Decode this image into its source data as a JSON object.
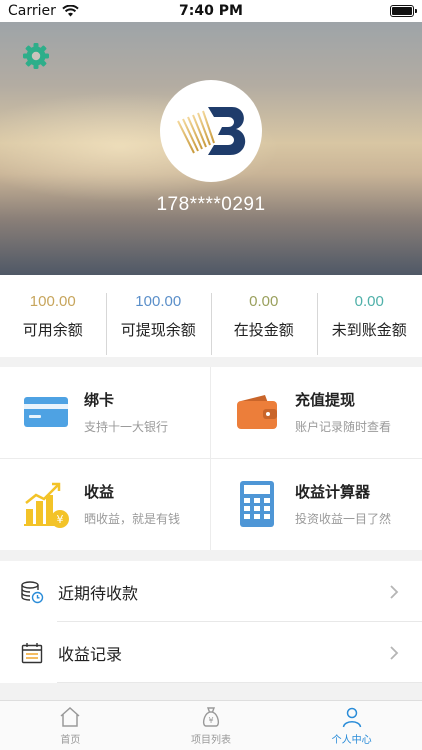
{
  "status_bar": {
    "carrier": "Carrier",
    "time": "7:40 PM"
  },
  "profile": {
    "phone": "178****0291"
  },
  "stats": [
    {
      "value": "100.00",
      "label": "可用余额",
      "color": "#c7a55c"
    },
    {
      "value": "100.00",
      "label": "可提现余额",
      "color": "#5b8fc9"
    },
    {
      "value": "0.00",
      "label": "在投金额",
      "color": "#9aa05d"
    },
    {
      "value": "0.00",
      "label": "未到账金额",
      "color": "#4fb0a9"
    }
  ],
  "features": [
    {
      "title": "绑卡",
      "subtitle": "支持十一大银行",
      "icon": "bank-card-icon"
    },
    {
      "title": "充值提现",
      "subtitle": "账户记录随时查看",
      "icon": "wallet-icon"
    },
    {
      "title": "收益",
      "subtitle": "晒收益，就是有钱",
      "icon": "earnings-chart-icon"
    },
    {
      "title": "收益计算器",
      "subtitle": "投资收益一目了然",
      "icon": "calculator-icon"
    }
  ],
  "list": [
    {
      "label": "近期待收款",
      "icon": "coins-clock-icon"
    },
    {
      "label": "收益记录",
      "icon": "calendar-icon"
    }
  ],
  "tabs": [
    {
      "label": "首页",
      "icon": "home-icon",
      "active": false
    },
    {
      "label": "项目列表",
      "icon": "money-bag-icon",
      "active": false
    },
    {
      "label": "个人中心",
      "icon": "person-icon",
      "active": true
    }
  ],
  "colors": {
    "accent": "#2a8cd8",
    "gear": "#2eae8a"
  }
}
